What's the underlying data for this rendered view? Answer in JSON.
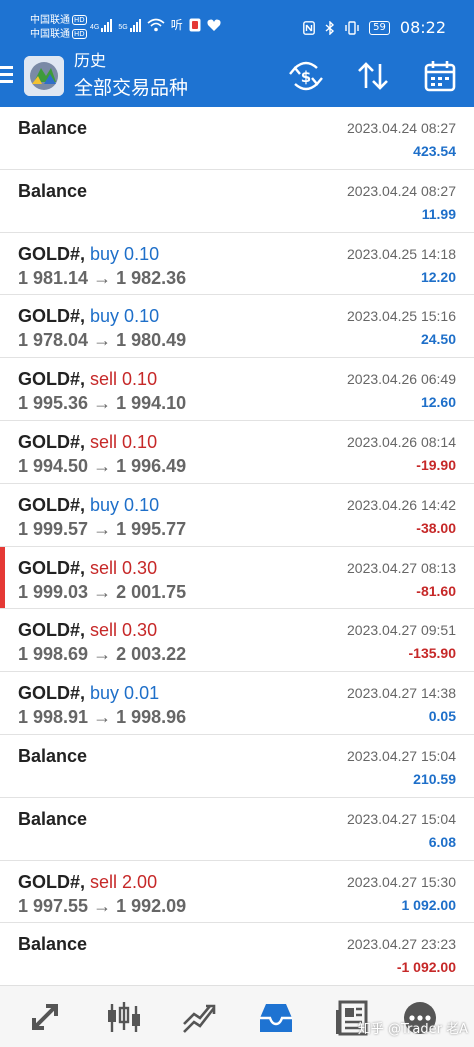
{
  "status_bar": {
    "carrier1": "中国联通",
    "carrier2": "中国联通",
    "hd": "HD",
    "net1": "4G",
    "net2": "5G",
    "extra": "听",
    "battery": "59",
    "time": "08:22"
  },
  "header": {
    "title": "历史",
    "subtitle": "全部交易品种"
  },
  "rows": [
    {
      "kind": "balance",
      "title": "Balance",
      "date": "2023.04.24 08:27",
      "profit": "423.54",
      "sign": "pos"
    },
    {
      "kind": "balance",
      "title": "Balance",
      "date": "2023.04.24 08:27",
      "profit": "11.99",
      "sign": "pos"
    },
    {
      "kind": "trade",
      "symbol": "GOLD#,",
      "side": "buy 0.10",
      "side_type": "buy",
      "prices": "1 981.14 → 1 982.36",
      "date": "2023.04.25 14:18",
      "profit": "12.20",
      "sign": "pos"
    },
    {
      "kind": "trade",
      "symbol": "GOLD#,",
      "side": "buy 0.10",
      "side_type": "buy",
      "prices": "1 978.04 → 1 980.49",
      "date": "2023.04.25 15:16",
      "profit": "24.50",
      "sign": "pos"
    },
    {
      "kind": "trade",
      "symbol": "GOLD#,",
      "side": "sell 0.10",
      "side_type": "sell",
      "prices": "1 995.36 → 1 994.10",
      "date": "2023.04.26 06:49",
      "profit": "12.60",
      "sign": "pos"
    },
    {
      "kind": "trade",
      "symbol": "GOLD#,",
      "side": "sell 0.10",
      "side_type": "sell",
      "prices": "1 994.50 → 1 996.49",
      "date": "2023.04.26 08:14",
      "profit": "-19.90",
      "sign": "neg"
    },
    {
      "kind": "trade",
      "symbol": "GOLD#,",
      "side": "buy 0.10",
      "side_type": "buy",
      "prices": "1 999.57 → 1 995.77",
      "date": "2023.04.26 14:42",
      "profit": "-38.00",
      "sign": "neg"
    },
    {
      "kind": "trade",
      "symbol": "GOLD#,",
      "side": "sell 0.30",
      "side_type": "sell",
      "prices": "1 999.03 → 2 001.75",
      "date": "2023.04.27 08:13",
      "profit": "-81.60",
      "sign": "neg",
      "selected": true
    },
    {
      "kind": "trade",
      "symbol": "GOLD#,",
      "side": "sell 0.30",
      "side_type": "sell",
      "prices": "1 998.69 → 2 003.22",
      "date": "2023.04.27 09:51",
      "profit": "-135.90",
      "sign": "neg"
    },
    {
      "kind": "trade",
      "symbol": "GOLD#,",
      "side": "buy 0.01",
      "side_type": "buy",
      "prices": "1 998.91 → 1 998.96",
      "date": "2023.04.27 14:38",
      "profit": "0.05",
      "sign": "pos"
    },
    {
      "kind": "balance",
      "title": "Balance",
      "date": "2023.04.27 15:04",
      "profit": "210.59",
      "sign": "pos"
    },
    {
      "kind": "balance",
      "title": "Balance",
      "date": "2023.04.27 15:04",
      "profit": "6.08",
      "sign": "pos"
    },
    {
      "kind": "trade",
      "symbol": "GOLD#,",
      "side": "sell 2.00",
      "side_type": "sell",
      "prices": "1 997.55 → 1 992.09",
      "date": "2023.04.27 15:30",
      "profit": "1 092.00",
      "sign": "pos"
    },
    {
      "kind": "balance",
      "title": "Balance",
      "date": "2023.04.27 23:23",
      "profit": "-1 092.00",
      "sign": "neg"
    }
  ],
  "bottom_nav": {
    "items": [
      "quotes-icon",
      "chart-icon",
      "trade-icon",
      "history-icon",
      "news-icon",
      "chat-icon"
    ],
    "active": "history-icon",
    "watermark": "知乎 @Trader 老A"
  },
  "colors": {
    "header_bg": "#1e73d2",
    "buy": "#1e6fc9",
    "sell": "#c62828",
    "selected_marker": "#e53935"
  }
}
